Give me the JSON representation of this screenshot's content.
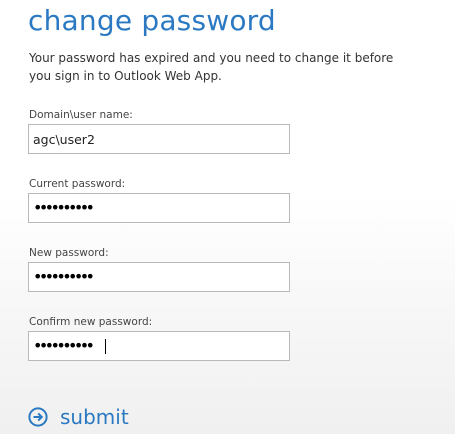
{
  "title": "change password",
  "message": "Your password has expired and you need to change it before you sign in to Outlook Web App.",
  "fields": {
    "username": {
      "label": "Domain\\user name:",
      "value": "agc\\user2"
    },
    "current_password": {
      "label": "Current password:",
      "masked": "••••••••••"
    },
    "new_password": {
      "label": "New password:",
      "masked": "••••••••••"
    },
    "confirm_password": {
      "label": "Confirm new password:",
      "masked": "••••••••••"
    }
  },
  "submit": {
    "label": "submit",
    "icon": "arrow-circle-right-icon"
  },
  "colors": {
    "accent": "#2b79c2",
    "text": "#333333",
    "border": "#b9b9b9"
  }
}
